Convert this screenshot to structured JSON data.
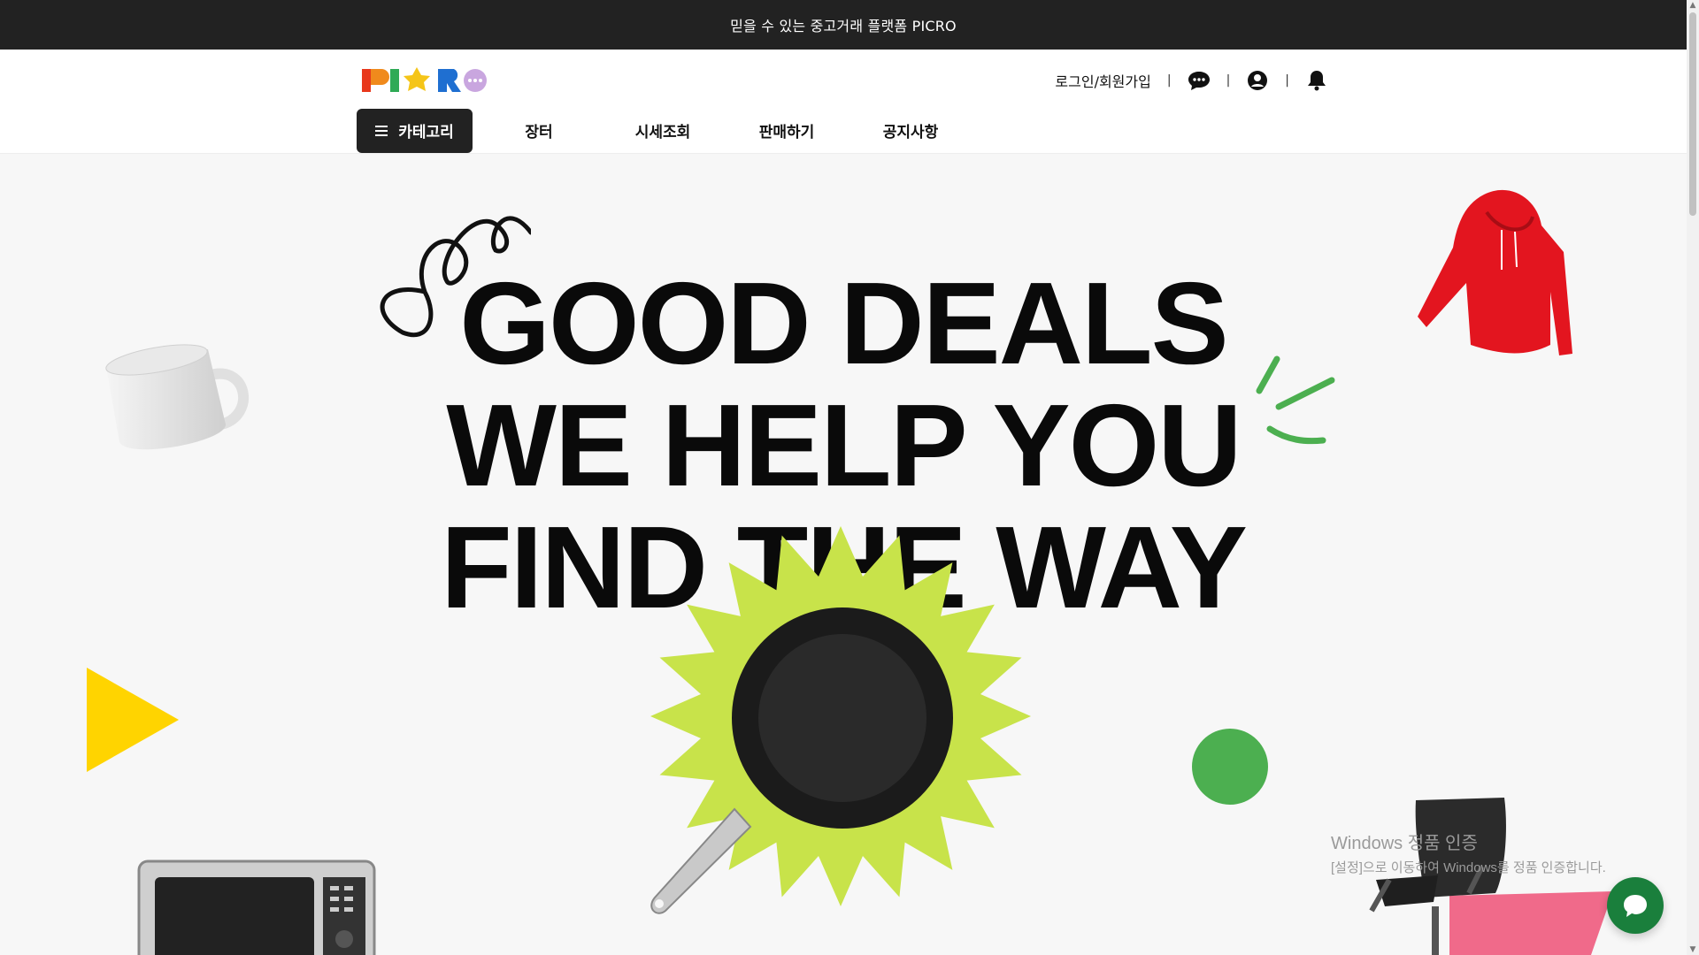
{
  "banner": {
    "text": "믿을 수 있는 중고거래 플랫폼 PICRO"
  },
  "header": {
    "logo_text": "PICRO",
    "login_label": "로그인/회원가입",
    "separator": "|",
    "icons": [
      "chat-icon",
      "user-icon",
      "bell-icon"
    ]
  },
  "nav": {
    "category_label": "카테고리",
    "items": [
      "장터",
      "시세조회",
      "판매하기",
      "공지사항"
    ]
  },
  "hero": {
    "line1": "GOOD DEALS",
    "line2": "WE HELP YOU",
    "line3": "FIND THE WAY"
  },
  "windows_watermark": {
    "title": "Windows 정품 인증",
    "subtitle": "[설정]으로 이동하여 Windows를 정품 인증합니다."
  },
  "colors": {
    "topbar": "#222222",
    "accent_green": "#4caf50",
    "lime": "#c8e34a",
    "yellow": "#ffd400",
    "pink": "#f06a8a",
    "fab_green": "#1a7f3c"
  }
}
